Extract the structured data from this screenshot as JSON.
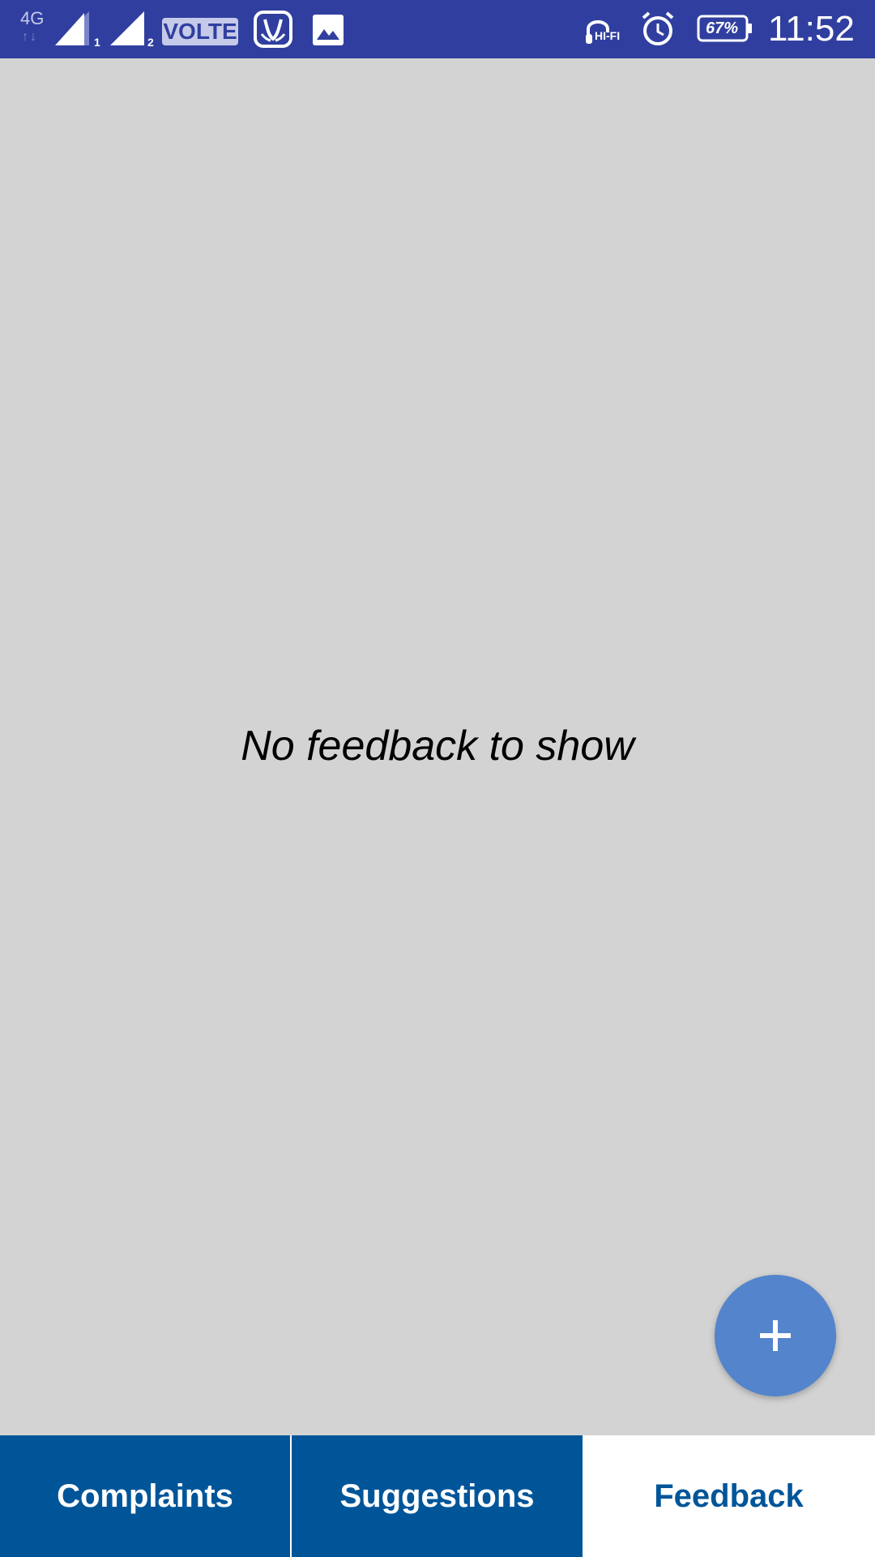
{
  "status_bar": {
    "network_type": "4G",
    "network_arrows": "↑↓",
    "sim1_label": "1",
    "sim2_label": "2",
    "volte_label": "VOLTE",
    "hifi_label": "HI-FI",
    "battery_percent": "67%",
    "time": "11:52",
    "icons": [
      "signal-icon",
      "saavn-icon",
      "gallery-icon",
      "hifi-headphones-icon",
      "alarm-icon",
      "battery-icon"
    ]
  },
  "main": {
    "empty_message": "No feedback to show"
  },
  "fab": {
    "icon": "plus-icon"
  },
  "tabs": [
    {
      "label": "Complaints",
      "selected": false
    },
    {
      "label": "Suggestions",
      "selected": false
    },
    {
      "label": "Feedback",
      "selected": true
    }
  ],
  "colors": {
    "status_bar": "#303f9f",
    "background": "#d3d3d3",
    "fab": "#5384cc",
    "tab_primary": "#005599",
    "tab_selected_bg": "#ffffff"
  }
}
